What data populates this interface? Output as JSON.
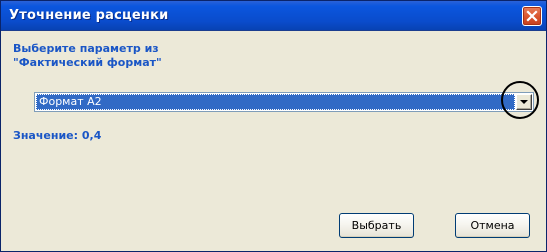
{
  "window": {
    "title": "Уточнение расценки"
  },
  "prompt": {
    "line1": "Выберите параметр из",
    "line2": "\"Фактический формат\""
  },
  "combo": {
    "selected_value": "Формат A2"
  },
  "value": {
    "label": "Значение:",
    "number": "0,4"
  },
  "buttons": {
    "select_label": "Выбрать",
    "cancel_label": "Отмена"
  },
  "icons": {
    "close": "close-icon",
    "dropdown": "chevron-down-icon"
  },
  "colors": {
    "title_bar": "#0a4ccc",
    "accent_text": "#1a56c6",
    "selection": "#316ac5",
    "close_button": "#d9542c",
    "dialog_bg": "#ece9d8"
  }
}
